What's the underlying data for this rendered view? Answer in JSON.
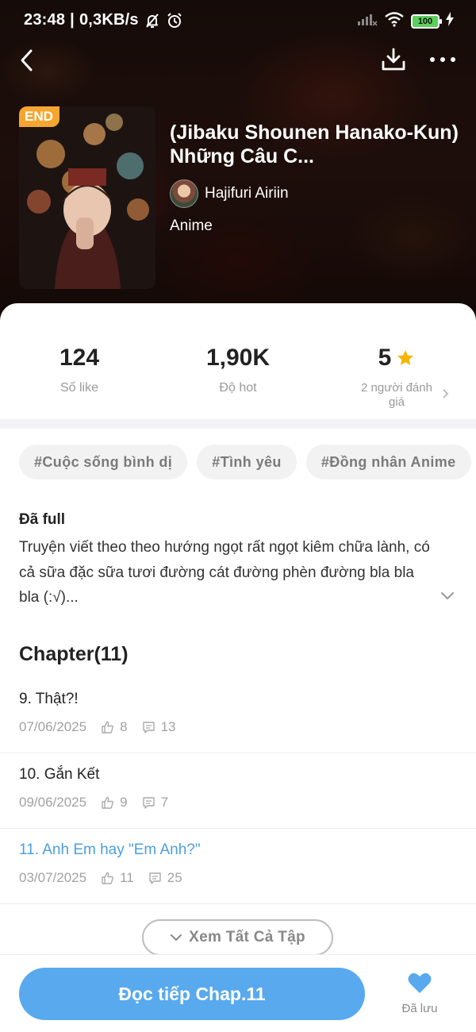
{
  "status_bar": {
    "time": "23:48",
    "network_speed": "0,3KB/s",
    "battery": "100",
    "separator": "|"
  },
  "novel": {
    "badge": "END",
    "title": "(Jibaku Shounen Hanako-Kun) Những Câu C...",
    "author": "Hajifuri Airiin",
    "genre": "Anime"
  },
  "stats": {
    "likes": {
      "value": "124",
      "label": "Số like"
    },
    "hot": {
      "value": "1,90K",
      "label": "Độ hot"
    },
    "rating": {
      "value": "5",
      "label": "2 người đánh giá"
    }
  },
  "tags": [
    "#Cuộc sống bình dị",
    "#Tình yêu",
    "#Đồng nhân Anime"
  ],
  "description": {
    "status": "Đã full",
    "text": "Truyện viết theo theo hướng ngọt rất ngọt kiêm chữa lành, có cả sữa đặc sữa tươi đường cát đường phèn đường bla bla bla (:√)..."
  },
  "chapters_heading": "Chapter(11)",
  "chapters": [
    {
      "title": "9. Thật?!",
      "date": "07/06/2025",
      "likes": "8",
      "comments": "13",
      "active": false
    },
    {
      "title": "10. Gắn Kết",
      "date": "09/06/2025",
      "likes": "9",
      "comments": "7",
      "active": false
    },
    {
      "title": "11. Anh Em hay \"Em Anh?\"",
      "date": "03/07/2025",
      "likes": "11",
      "comments": "25",
      "active": true
    }
  ],
  "see_all_label": "Xem Tất Cả Tập",
  "read_button": "Đọc tiếp Chap.11",
  "saved_label": "Đã lưu",
  "colors": {
    "accent": "#58a9ee",
    "link": "#4b9fe0",
    "badge": "#f4a630",
    "star": "#f7b500"
  }
}
